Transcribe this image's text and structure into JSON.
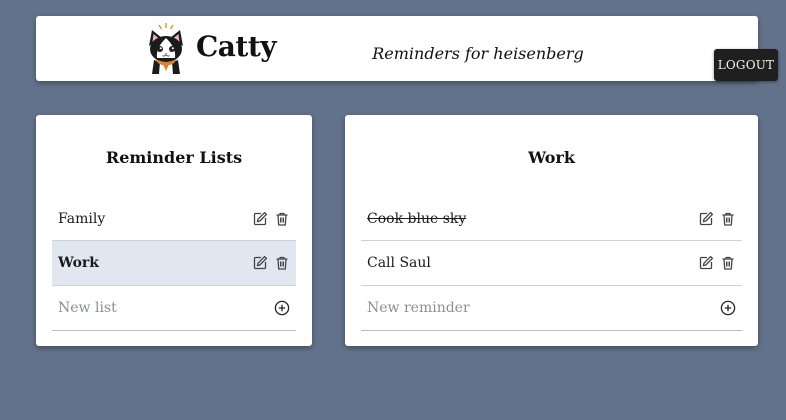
{
  "header": {
    "brand": "Catty",
    "subtitle": "Reminders for heisenberg",
    "logout_label": "LOGOUT",
    "logo_icon": "cat-logo-icon"
  },
  "lists_panel": {
    "title": "Reminder Lists",
    "items": [
      {
        "label": "Family",
        "selected": false
      },
      {
        "label": "Work",
        "selected": true
      }
    ],
    "new_placeholder": "New list"
  },
  "reminders_panel": {
    "title": "Work",
    "items": [
      {
        "label": "Cook blue sky",
        "done": true
      },
      {
        "label": "Call Saul",
        "done": false
      }
    ],
    "new_placeholder": "New reminder"
  },
  "icons": {
    "edit": "edit-icon",
    "delete": "trash-icon",
    "add": "plus-circle-icon"
  },
  "colors": {
    "background": "#63728b",
    "selected_row": "#e1e7f0",
    "logout_button": "#1f1f1f"
  }
}
